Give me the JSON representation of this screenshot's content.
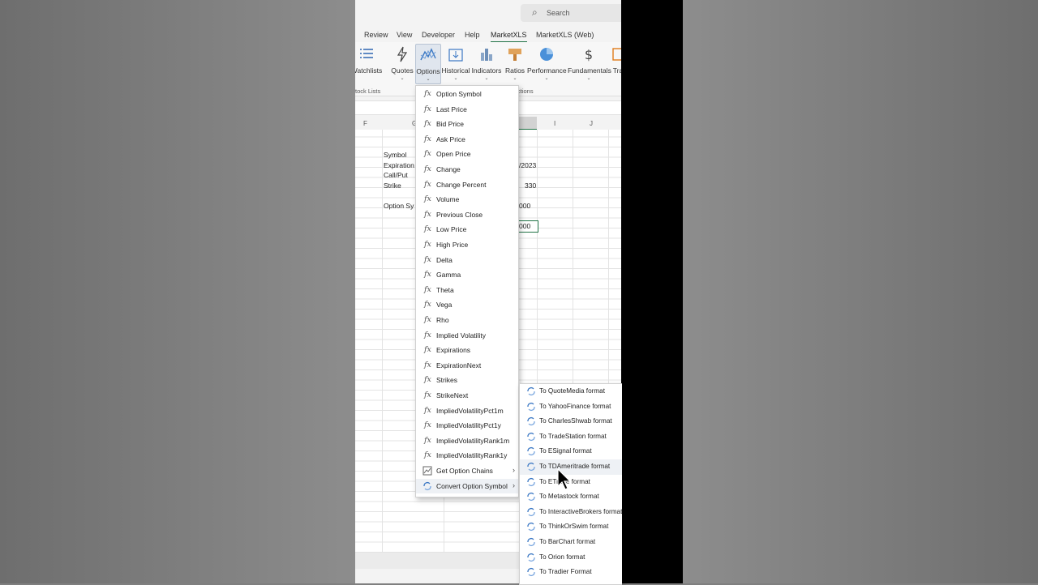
{
  "search": {
    "placeholder": "Search",
    "icon": "search-icon"
  },
  "menu_tabs": [
    "Review",
    "View",
    "Developer",
    "Help",
    "MarketXLS",
    "MarketXLS (Web)"
  ],
  "active_tab": "MarketXLS",
  "ribbon": {
    "buttons": [
      {
        "label": "Watchlists",
        "icon": "list-icon"
      },
      {
        "label": "Quotes",
        "icon": "lightning-icon"
      },
      {
        "label": "Options",
        "icon": "line-chart-icon",
        "selected": true
      },
      {
        "label": "Historical",
        "icon": "calendar-icon"
      },
      {
        "label": "Indicators",
        "icon": "bar-chart-icon"
      },
      {
        "label": "Ratios",
        "icon": "scale-icon"
      },
      {
        "label": "Performance",
        "icon": "pie-chart-icon"
      },
      {
        "label": "Fundamentals",
        "icon": "dollar-icon"
      },
      {
        "label": "Tra",
        "icon": "trade-icon"
      }
    ],
    "groups": {
      "stock_lists": "tock Lists",
      "functions": "ctions"
    }
  },
  "columns": {
    "f": "F",
    "g": "G",
    "i": "I",
    "j": "J"
  },
  "cells": {
    "symbol": "Symbol",
    "expiration": "Expiration",
    "call_put": "Call/Put",
    "strike": "Strike",
    "option_symbol": "Option Sy",
    "exp_value": "/2023",
    "strike_value": "330",
    "value_row1": "000",
    "value_row2": "000"
  },
  "dropdown": {
    "items": [
      "Option Symbol",
      "Last Price",
      "Bid Price",
      "Ask Price",
      "Open Price",
      "Change",
      "Change Percent",
      "Volume",
      "Previous Close",
      "Low Price",
      "High Price",
      "Delta",
      "Gamma",
      "Theta",
      "Vega",
      "Rho",
      "Implied Volatility",
      "Expirations",
      "ExpirationNext",
      "Strikes",
      "StrikeNext",
      "ImpliedVolatilityPct1m",
      "ImpliedVolatilityPct1y",
      "ImpliedVolatilityRank1m",
      "ImpliedVolatilityRank1y"
    ],
    "get_option_chains": "Get Option Chains",
    "convert_option_symbol": "Convert Option Symbol",
    "submenu_arrow": "›"
  },
  "submenu": {
    "items": [
      "To QuoteMedia format",
      "To YahooFinance format",
      "To CharlesShwab format",
      "To TradeStation format",
      "To ESignal format",
      "To TDAmeritrade format",
      "To ETrade format",
      "To Metastock format",
      "To InteractiveBrokers format",
      "To ThinkOrSwim format",
      "To BarChart format",
      "To Orion format",
      "To Tradier Format"
    ],
    "highlighted": "To TDAmeritrade format"
  },
  "colors": {
    "accent": "#217346",
    "fx": "#555555",
    "convert_icon": "#3b78c4"
  }
}
